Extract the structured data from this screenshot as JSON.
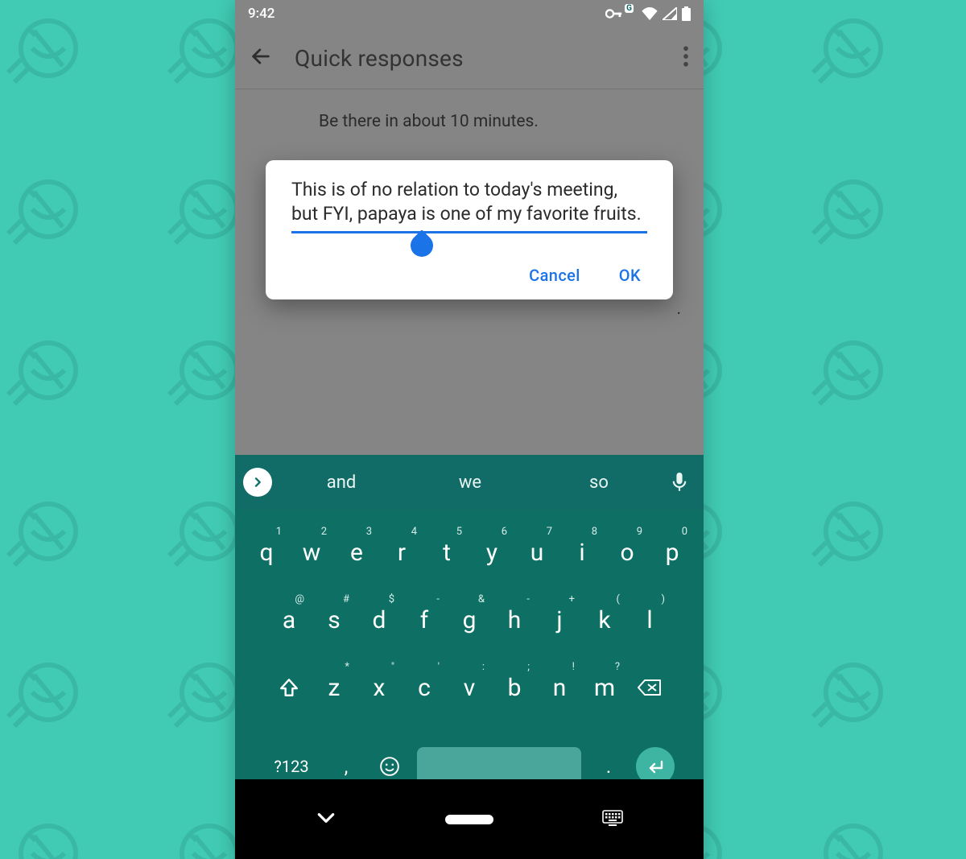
{
  "status": {
    "time": "9:42"
  },
  "appbar": {
    "title": "Quick responses"
  },
  "list": {
    "item0": "Be there in about 10 minutes."
  },
  "peek_fragment": ".",
  "dialog": {
    "text": "This is of no relation to today's meeting, but FYI, papaya is one of my favorite fruits.",
    "cancel": "Cancel",
    "ok": "OK"
  },
  "keyboard": {
    "suggestions": [
      "and",
      "we",
      "so"
    ],
    "row1": [
      {
        "k": "q",
        "s": "1"
      },
      {
        "k": "w",
        "s": "2"
      },
      {
        "k": "e",
        "s": "3"
      },
      {
        "k": "r",
        "s": "4"
      },
      {
        "k": "t",
        "s": "5"
      },
      {
        "k": "y",
        "s": "6"
      },
      {
        "k": "u",
        "s": "7"
      },
      {
        "k": "i",
        "s": "8"
      },
      {
        "k": "o",
        "s": "9"
      },
      {
        "k": "p",
        "s": "0"
      }
    ],
    "row2": [
      {
        "k": "a",
        "s": "@"
      },
      {
        "k": "s",
        "s": "#"
      },
      {
        "k": "d",
        "s": "$"
      },
      {
        "k": "f",
        "s": "-"
      },
      {
        "k": "g",
        "s": "&"
      },
      {
        "k": "h",
        "s": "-"
      },
      {
        "k": "j",
        "s": "+"
      },
      {
        "k": "k",
        "s": "("
      },
      {
        "k": "l",
        "s": ")"
      }
    ],
    "row3": [
      {
        "k": "z",
        "s": "*"
      },
      {
        "k": "x",
        "s": "\""
      },
      {
        "k": "c",
        "s": "'"
      },
      {
        "k": "v",
        "s": ":"
      },
      {
        "k": "b",
        "s": ";"
      },
      {
        "k": "n",
        "s": "!"
      },
      {
        "k": "m",
        "s": "?"
      }
    ],
    "symKey": "?123",
    "comma": ",",
    "period": "."
  }
}
